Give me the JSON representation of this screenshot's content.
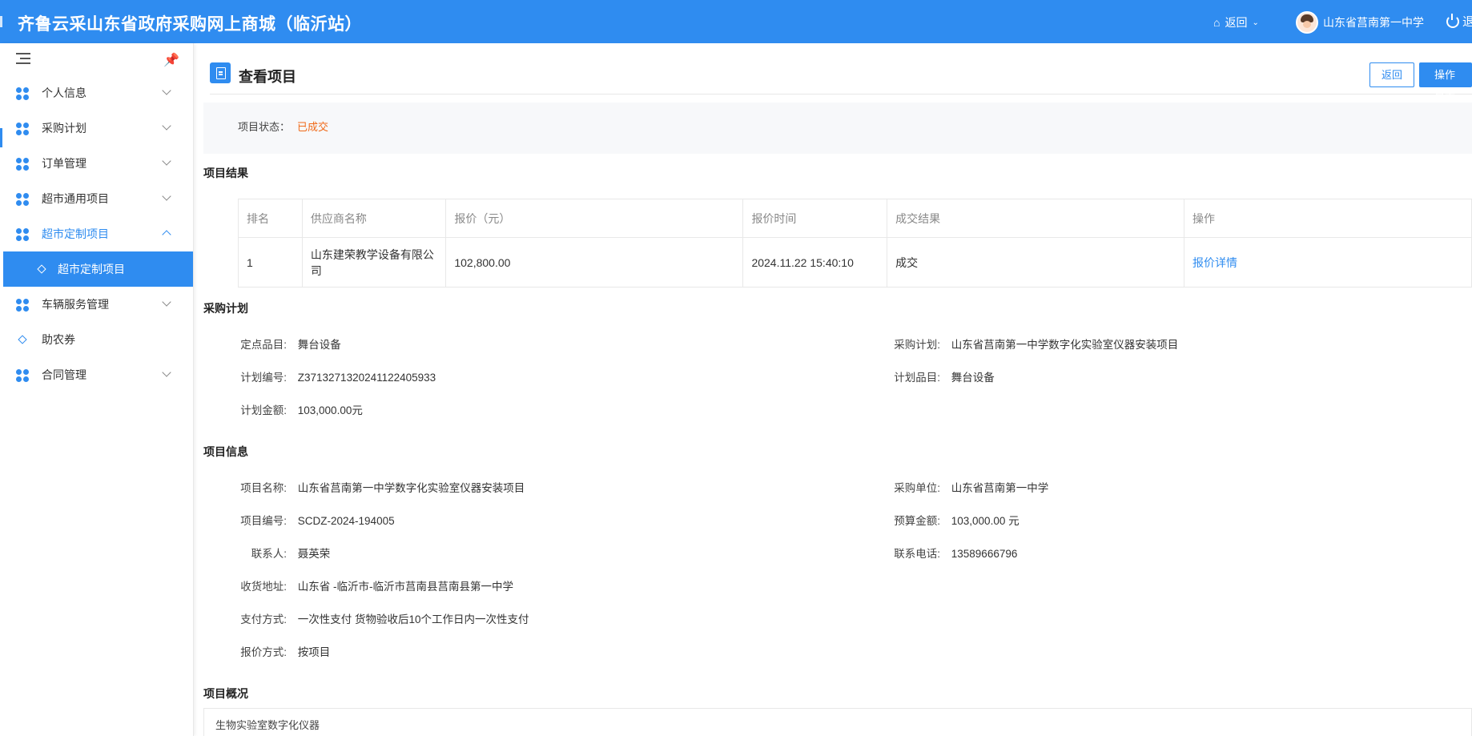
{
  "header": {
    "title": "齐鲁云采山东省政府采购网上商城（临沂站）",
    "back_label": "返回",
    "user_name": "山东省莒南第一中学",
    "logout_label": "退"
  },
  "sidebar": {
    "items": [
      {
        "label": "个人信息"
      },
      {
        "label": "采购计划"
      },
      {
        "label": "订单管理"
      },
      {
        "label": "超市通用项目"
      },
      {
        "label": "超市定制项目"
      },
      {
        "label": "超市定制项目"
      },
      {
        "label": "车辆服务管理"
      },
      {
        "label": "助农券"
      },
      {
        "label": "合同管理"
      }
    ]
  },
  "page": {
    "title": "查看项目",
    "back_button": "返回",
    "log_button": "操作日志",
    "status_label": "项目状态：",
    "status_value": "已成交",
    "accent_color": "#2f8cf0",
    "status_color": "#f06a19"
  },
  "result": {
    "section_title": "项目结果",
    "columns": [
      "排名",
      "供应商名称",
      "报价（元）",
      "报价时间",
      "成交结果",
      "操作"
    ],
    "rows": [
      {
        "rank": "1",
        "supplier_line1": "山东建荣教学设备有限公",
        "supplier_line2": "司",
        "price": "102,800.00",
        "time": "2024.11.22 15:40:10",
        "result": "成交",
        "action": "报价详情"
      }
    ]
  },
  "plan": {
    "section_title": "采购计划",
    "item_label": "定点品目:",
    "item_value": "舞台设备",
    "plan_label": "采购计划:",
    "plan_value": "山东省莒南第一中学数字化实验室仪器安装项目",
    "code_label": "计划编号:",
    "code_value": "Z3713271320241122405933",
    "category_label": "计划品目:",
    "category_value": "舞台设备",
    "amount_label": "计划金额:",
    "amount_value": "103,000.00元"
  },
  "info": {
    "section_title": "项目信息",
    "name_label": "项目名称:",
    "name_value": "山东省莒南第一中学数字化实验室仪器安装项目",
    "unit_label": "采购单位:",
    "unit_value": "山东省莒南第一中学",
    "no_label": "项目编号:",
    "no_value": "SCDZ-2024-194005",
    "budget_label": "预算金额:",
    "budget_value": "103,000.00 元",
    "contact_label": "联系人:",
    "contact_value": "聂英荣",
    "phone_label": "联系电话:",
    "phone_value": "13589666796",
    "address_label": "收货地址:",
    "address_value": "山东省 -临沂市-临沂市莒南县莒南县第一中学",
    "pay_label": "支付方式:",
    "pay_value": "一次性支付 货物验收后10个工作日内一次性支付",
    "quote_label": "报价方式:",
    "quote_value": "按项目"
  },
  "overview": {
    "section_title": "项目概况",
    "text": "生物实验室数字化仪器"
  }
}
